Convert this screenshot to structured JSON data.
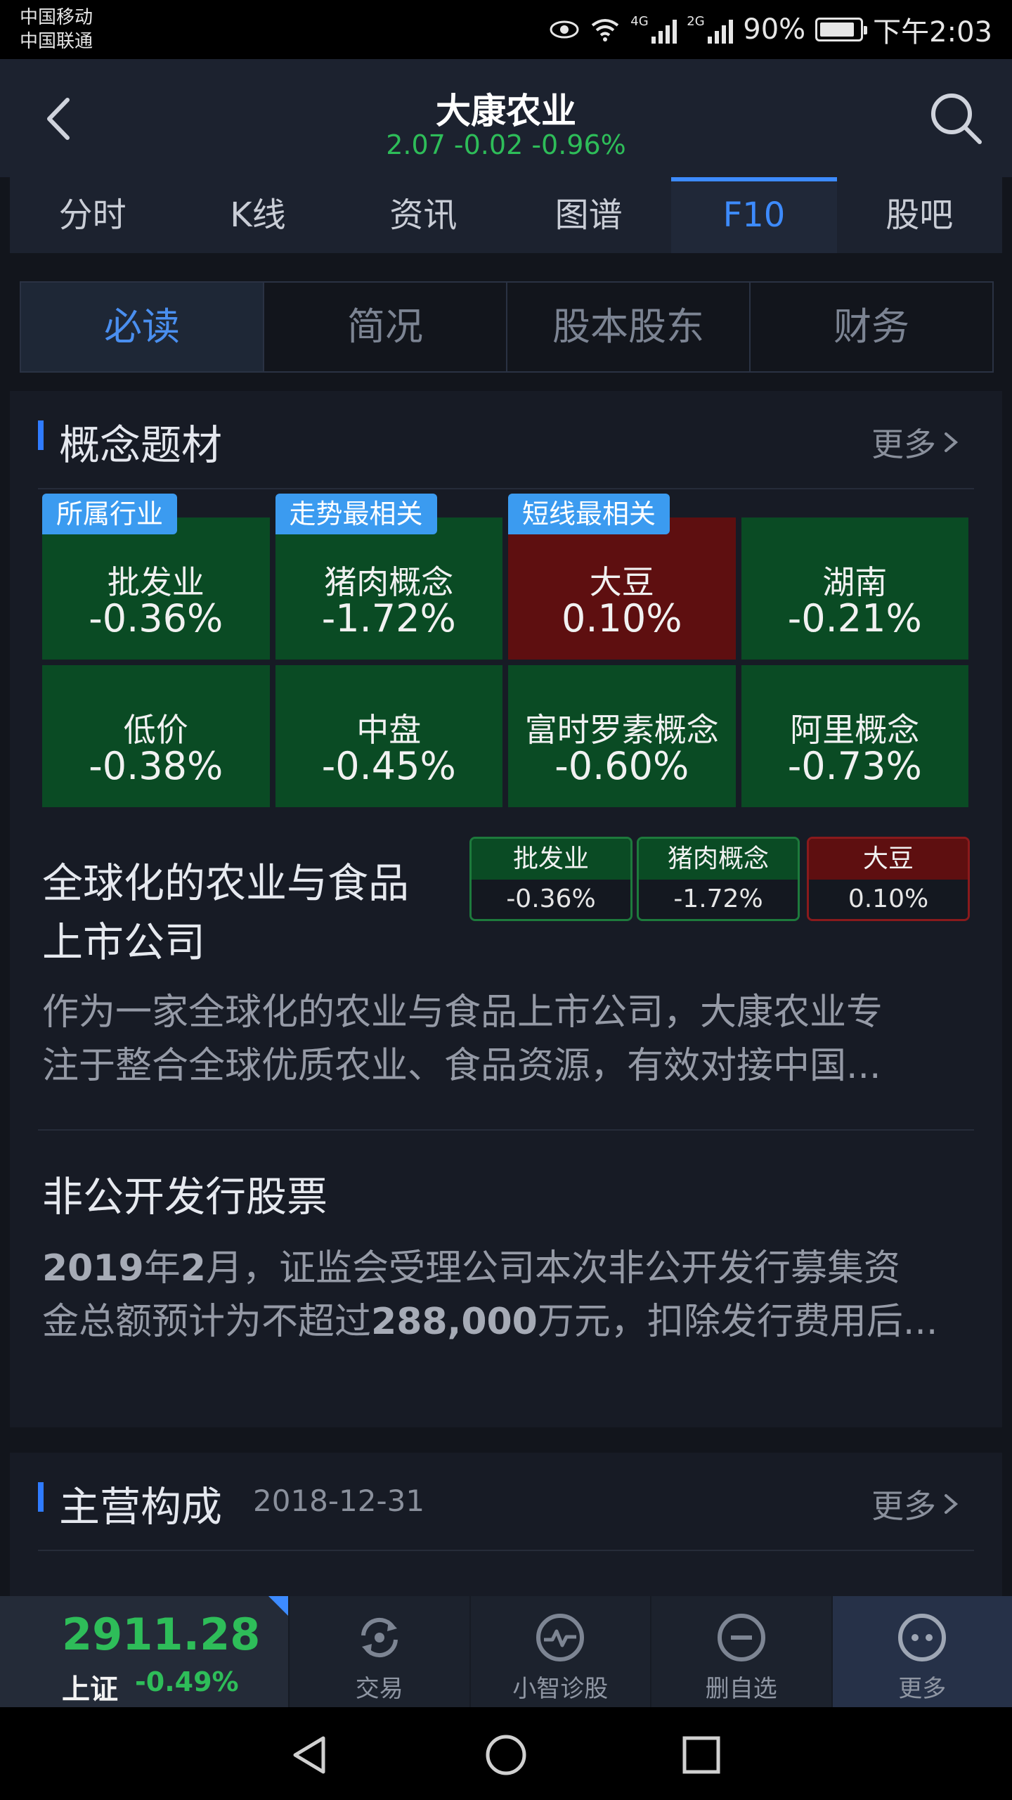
{
  "status_bar": {
    "carrier_1": "中国移动",
    "carrier_2": "中国联通",
    "net_1": "4G",
    "net_2": "2G",
    "battery": "90%",
    "time": "下午2:03"
  },
  "header": {
    "title": "大康农业",
    "quote": "2.07  -0.02  -0.96%"
  },
  "main_tabs": [
    {
      "label": "分时"
    },
    {
      "label": "K线"
    },
    {
      "label": "资讯"
    },
    {
      "label": "图谱"
    },
    {
      "label": "F10",
      "active": true
    },
    {
      "label": "股吧"
    }
  ],
  "sub_tabs": [
    {
      "label": "必读",
      "active": true
    },
    {
      "label": "简况"
    },
    {
      "label": "股本股东"
    },
    {
      "label": "财务"
    }
  ],
  "concept": {
    "title": "概念题材",
    "more": "更多",
    "cells": [
      {
        "name": "批发业",
        "value": "-0.36%",
        "badge": "所属行业",
        "color": "green"
      },
      {
        "name": "猪肉概念",
        "value": "-1.72%",
        "badge": "走势最相关",
        "color": "green"
      },
      {
        "name": "大豆",
        "value": "0.10%",
        "badge": "短线最相关",
        "color": "red"
      },
      {
        "name": "湖南",
        "value": "-0.21%",
        "color": "green"
      },
      {
        "name": "低价",
        "value": "-0.38%",
        "color": "green"
      },
      {
        "name": "中盘",
        "value": "-0.45%",
        "color": "green"
      },
      {
        "name": "富时罗素概念",
        "value": "-0.60%",
        "color": "green"
      },
      {
        "name": "阿里概念",
        "value": "-0.73%",
        "color": "green"
      }
    ],
    "item1": {
      "title_line1": "全球化的农业与食品",
      "title_line2": "上市公司",
      "tags": [
        {
          "name": "批发业",
          "value": "-0.36%",
          "color": "green"
        },
        {
          "name": "猪肉概念",
          "value": "-1.72%",
          "color": "green"
        },
        {
          "name": "大豆",
          "value": "0.10%",
          "color": "red"
        }
      ],
      "desc_line1": "作为一家全球化的农业与食品上市公司，大康农业专",
      "desc_line2": "注于整合全球优质农业、食品资源，有效对接中国..."
    },
    "item2": {
      "title": "非公开发行股票",
      "desc_a": "2019",
      "desc_b": "年",
      "desc_c": "2",
      "desc_d": "月，证监会受理公司本次非公开发行募集资",
      "desc_e": "金总额预计为不超过",
      "desc_f": "288,000",
      "desc_g": "万元，扣除发行费用后..."
    }
  },
  "main_business": {
    "title": "主营构成",
    "date": "2018-12-31",
    "more": "更多"
  },
  "bottom_bar": {
    "index_value": "2911.28",
    "index_name": "上证",
    "index_change": "-0.49%",
    "buttons": [
      {
        "label": "交易",
        "icon": "trade-icon"
      },
      {
        "label": "小智诊股",
        "icon": "diagnose-icon"
      },
      {
        "label": "删自选",
        "icon": "remove-watchlist-icon"
      },
      {
        "label": "更多",
        "icon": "more-icon",
        "active": true
      }
    ]
  },
  "colors": {
    "up": "#5e0f10",
    "down": "#0a4b24",
    "accent": "#3d8bff",
    "quote_green": "#2ebd59"
  }
}
